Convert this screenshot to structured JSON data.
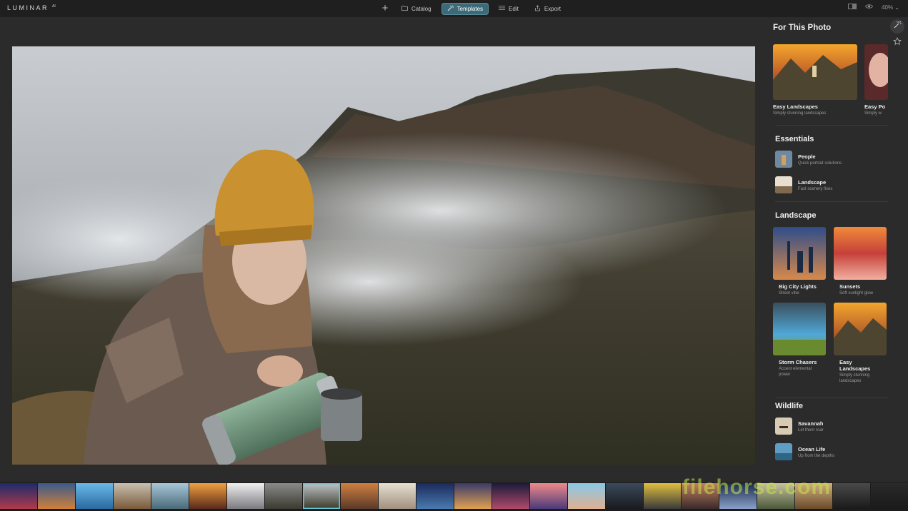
{
  "app": {
    "logo": "LUMINAR",
    "logo_version": "AI",
    "zoom": "40%"
  },
  "nav": {
    "add_icon": "plus-icon",
    "items": [
      {
        "label": "Catalog",
        "icon": "folder-icon",
        "active": false
      },
      {
        "label": "Templates",
        "icon": "magic-wand-icon",
        "active": true
      },
      {
        "label": "Edit",
        "icon": "sliders-icon",
        "active": false
      },
      {
        "label": "Export",
        "icon": "share-icon",
        "active": false
      }
    ]
  },
  "panel": {
    "title": "For This Photo",
    "for_this_photo": [
      {
        "title": "Easy Landscapes",
        "subtitle": "Simply stunning landscapes"
      },
      {
        "title": "Easy Po",
        "subtitle": "Simply w"
      }
    ],
    "essentials": {
      "heading": "Essentials",
      "items": [
        {
          "title": "People",
          "subtitle": "Quick portrait solutions"
        },
        {
          "title": "Landscape",
          "subtitle": "Fast scenery fixes"
        }
      ]
    },
    "landscape": {
      "heading": "Landscape",
      "items": [
        {
          "title": "Big City Lights",
          "subtitle": "Street vibe"
        },
        {
          "title": "Sunsets",
          "subtitle": "Soft sunlight glow"
        },
        {
          "title": "Storm Chasers",
          "subtitle": "Accent elemental power"
        },
        {
          "title": "Easy Landscapes",
          "subtitle": "Simply stunning landscapes"
        }
      ]
    },
    "wildlife": {
      "heading": "Wildlife",
      "items": [
        {
          "title": "Savannah",
          "subtitle": "Let them roar"
        },
        {
          "title": "Ocean Life",
          "subtitle": "Up from the depths"
        }
      ]
    }
  },
  "colors": {
    "accent": "#3d6a78",
    "selection": "#5ec4d8",
    "background": "#2b2b2c"
  },
  "watermark": "filehorse.com"
}
